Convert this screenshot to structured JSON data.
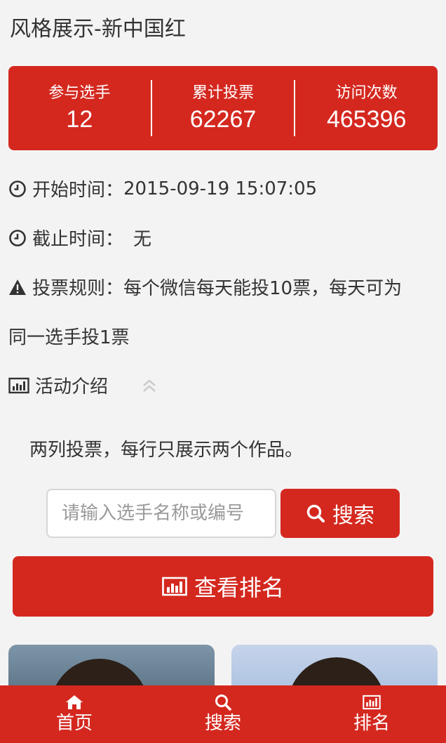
{
  "page": {
    "title": "风格展示-新中国红"
  },
  "stats": [
    {
      "label": "参与选手",
      "value": "12"
    },
    {
      "label": "累计投票",
      "value": "62267"
    },
    {
      "label": "访问次数",
      "value": "465396"
    }
  ],
  "info": {
    "start_label": "开始时间：",
    "start_value": "2015-09-19 15:07:05",
    "end_label": "截止时间：",
    "end_value": "无",
    "rules_label": "投票规则：",
    "rules_value": "每个微信每天能投10票，每天可为",
    "rules_cont": "同一选手投1票",
    "intro_label": "活动介绍",
    "intro_text": "两列投票，每行只展示两个作品。"
  },
  "search": {
    "placeholder": "请输入选手名称或编号",
    "button_label": "搜索"
  },
  "rank_button": {
    "label": "查看排名"
  },
  "tabbar": [
    {
      "label": "首页",
      "icon": "home-icon"
    },
    {
      "label": "搜索",
      "icon": "search-icon"
    },
    {
      "label": "排名",
      "icon": "bar-chart-icon"
    }
  ],
  "colors": {
    "accent": "#d4281f",
    "background": "#f3f3f3"
  }
}
